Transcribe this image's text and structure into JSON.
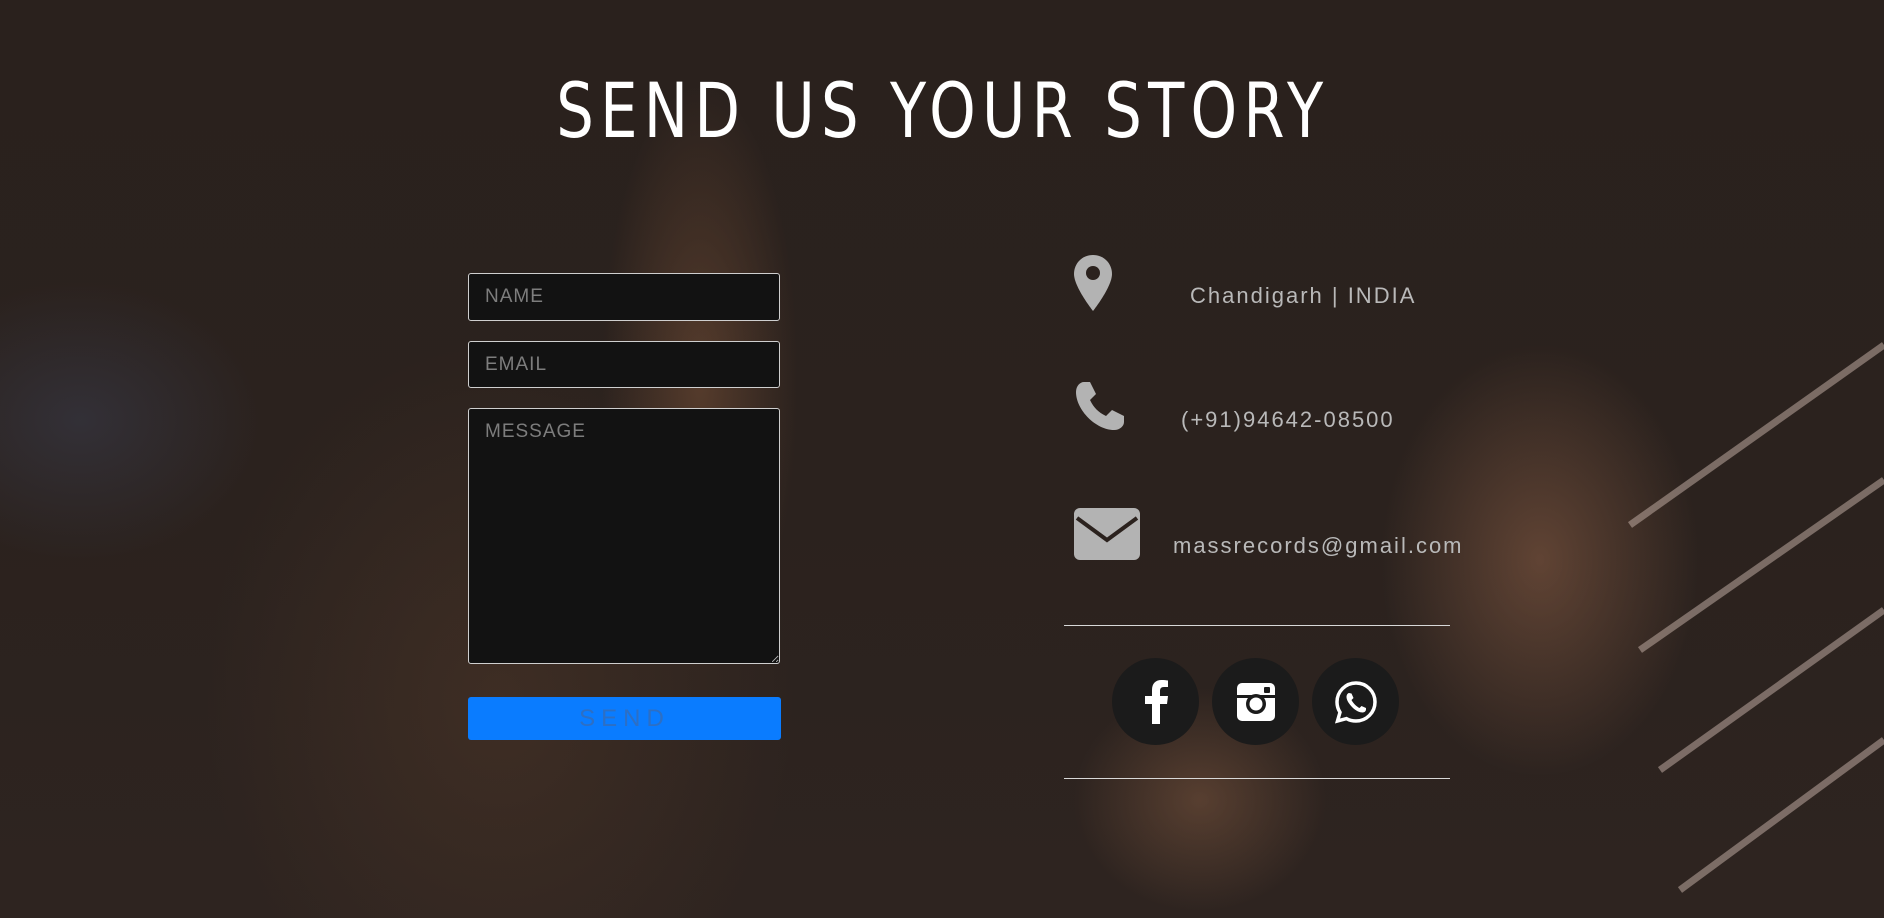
{
  "page": {
    "title": "SEND US YOUR STORY"
  },
  "form": {
    "name_placeholder": "NAME",
    "email_placeholder": "EMAIL",
    "message_placeholder": "MESSAGE",
    "send_label": "SEND"
  },
  "contact": {
    "address": "Chandigarh | INDIA",
    "phone": "(+91)94642-08500",
    "email": "massrecords@gmail.com",
    "address_icon": "map-pin-icon",
    "phone_icon": "phone-icon",
    "email_icon": "envelope-icon"
  },
  "social": {
    "items": [
      {
        "icon": "facebook-icon"
      },
      {
        "icon": "instagram-icon"
      },
      {
        "icon": "whatsapp-icon"
      }
    ]
  },
  "colors": {
    "accent": "#0a7cff",
    "icon_gray": "#b3b3b3",
    "text_gray": "#b9b9b9",
    "social_bg": "#1b1b1b"
  }
}
